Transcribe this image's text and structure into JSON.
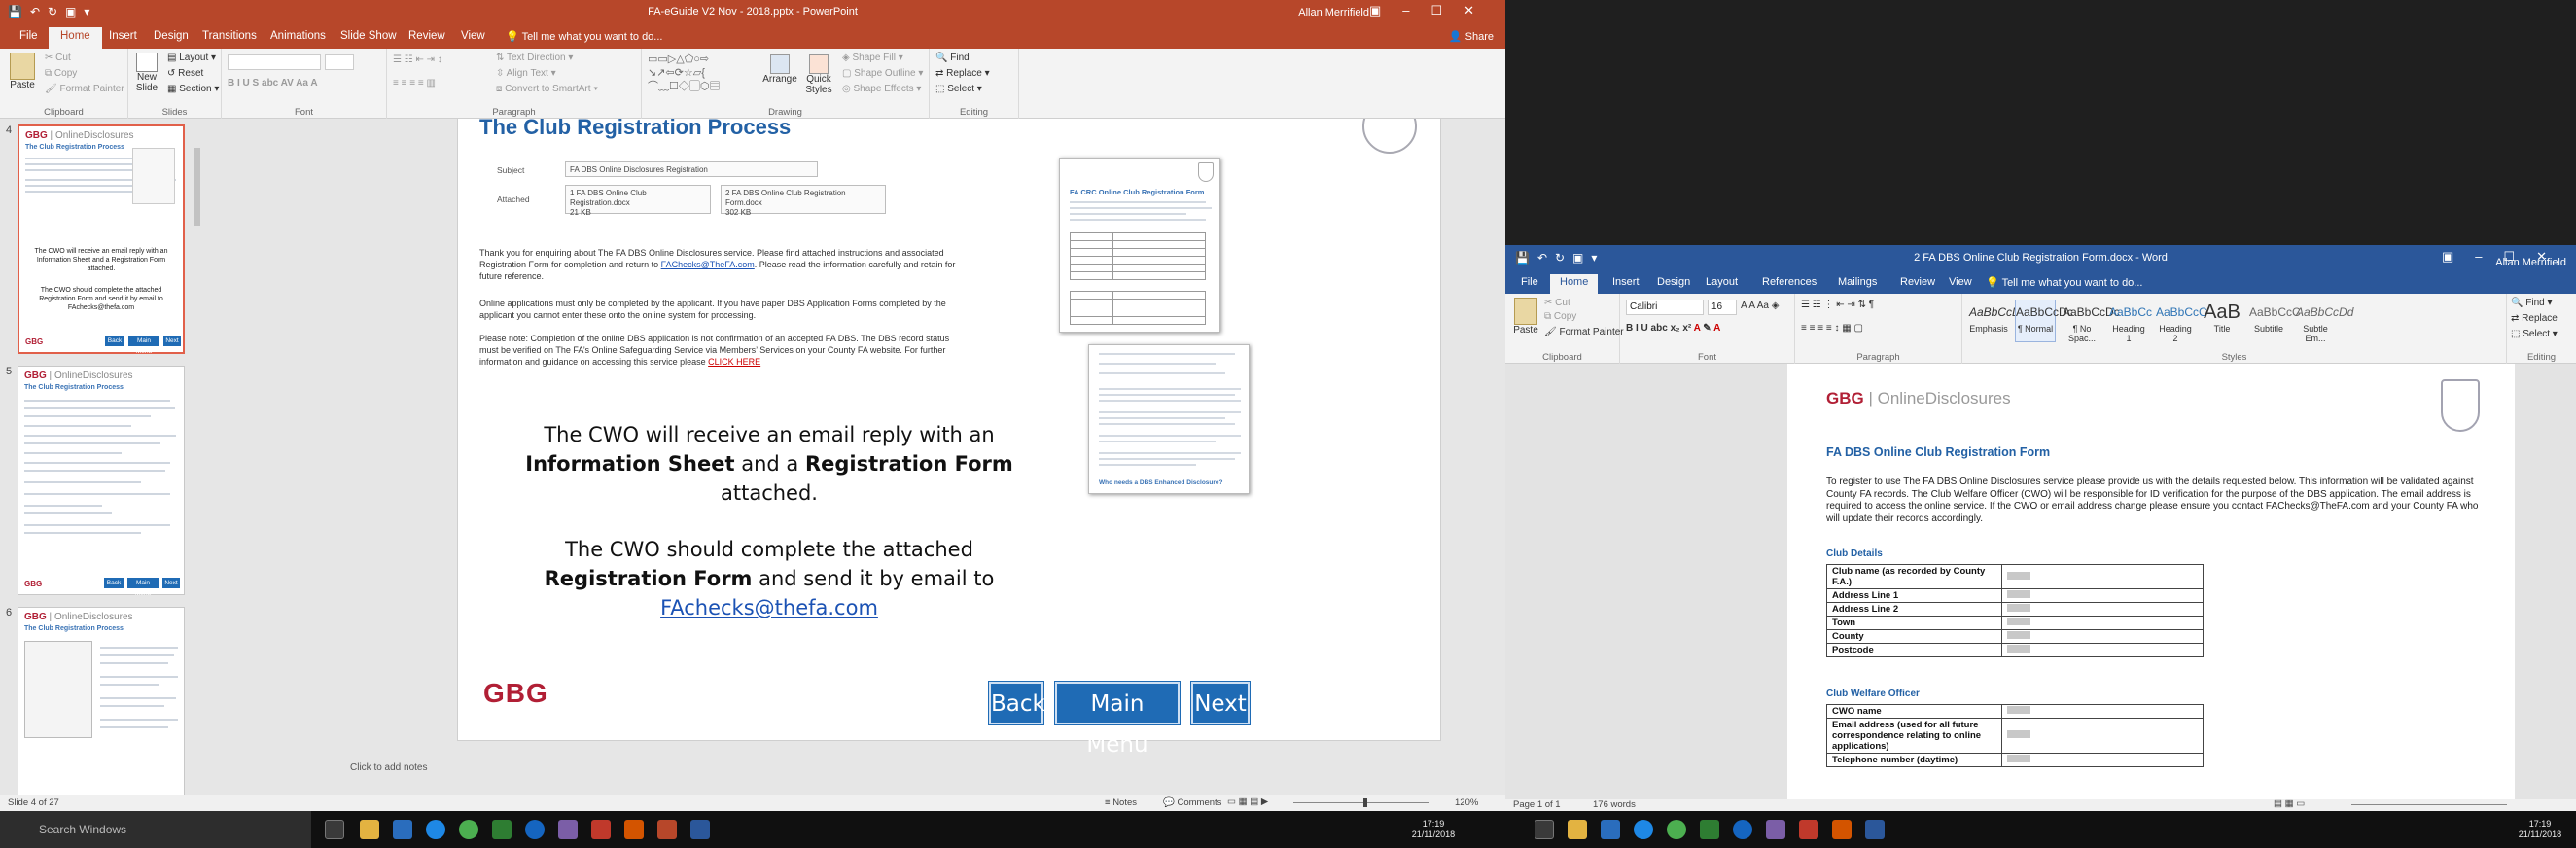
{
  "ppt": {
    "title": "FA-eGuide V2 Nov - 2018.pptx - PowerPoint",
    "user": "Allan Merrifield",
    "share": "Share",
    "tabs": [
      "File",
      "Home",
      "Insert",
      "Design",
      "Transitions",
      "Animations",
      "Slide Show",
      "Review",
      "View"
    ],
    "tell": "Tell me what you want to do...",
    "groups": [
      "Clipboard",
      "Slides",
      "Font",
      "Paragraph",
      "Drawing",
      "Editing"
    ],
    "ribbon": {
      "paste": "Paste",
      "cut": "Cut",
      "copy": "Copy",
      "format_painter": "Format Painter",
      "new_slide": "New Slide",
      "layout": "Layout",
      "reset": "Reset",
      "section": "Section",
      "text_direction": "Text Direction",
      "align_text": "Align Text",
      "convert_smartart": "Convert to SmartArt",
      "arrange": "Arrange",
      "quick_styles": "Quick Styles",
      "shape_fill": "Shape Fill",
      "shape_outline": "Shape Outline",
      "shape_effects": "Shape Effects",
      "find": "Find",
      "replace": "Replace",
      "select": "Select"
    },
    "slide_numbers": [
      "4",
      "5",
      "6"
    ],
    "thumb_title": "The Club Registration Process",
    "thumb_logo": "OnlineDisclosures",
    "thumb_buttons": [
      "Back",
      "Main Menu",
      "Next"
    ],
    "thumb4_text": [
      "The CWO will receive an email reply with an Information Sheet and a Registration Form attached.",
      "The CWO should complete the attached Registration Form and send it by email to FAchecks@thefa.com"
    ],
    "slide": {
      "title": "The Club Registration Process",
      "subject_label": "Subject",
      "subject_value": "FA DBS Online Disclosures Registration",
      "attached_label": "Attached",
      "att1": "1 FA DBS Online Club Registration.docx",
      "att1_size": "21 KB",
      "att2": "2 FA DBS Online Club Registration Form.docx",
      "att2_size": "302 KB",
      "p1a": "Thank you for enquiring about The FA DBS Online Disclosures service.  Please find attached instructions and associated Registration Form for completion and return to ",
      "p1_link": "FAChecks@TheFA.com",
      "p1b": ".  Please read the information carefully and retain for future reference.",
      "p2": "Online applications must only be completed by the applicant.  If you have paper DBS Application Forms completed by the applicant you cannot enter these onto the online system for processing.",
      "p3a": "Please note:  Completion of the online DBS application is not confirmation of an accepted FA DBS.  The DBS record status must be verified on The FA’s Online Safeguarding Service via Members’ Services on your County FA website.  For further information and guidance on accessing this service please ",
      "p3_link": "CLICK HERE",
      "big1a": "The CWO will receive an email reply with an",
      "big1b": "Information Sheet",
      "big1c": "and a",
      "big1d": "Registration Form",
      "big1e": "attached.",
      "big2a": "The CWO should complete the attached",
      "big2b": "Registration Form",
      "big2c": "and send it by email to",
      "big2_link": "FAchecks@thefa.com",
      "gbg": "GBG",
      "btn_back": "Back",
      "btn_menu": "Main Menu",
      "btn_next": "Next",
      "pic1_title": "FA CRC Online Club Registration Form",
      "pic2_heading": "Who needs a DBS Enhanced Disclosure?"
    },
    "notes": "Click to add notes",
    "status": "Slide 4 of 27",
    "status_notes": "Notes",
    "status_comments": "Comments",
    "zoom": "120%"
  },
  "word": {
    "title": "2 FA DBS Online Club Registration Form.docx - Word",
    "user": "Allan Merrifield",
    "tabs": [
      "File",
      "Home",
      "Insert",
      "Design",
      "Layout",
      "References",
      "Mailings",
      "Review",
      "View"
    ],
    "tell": "Tell me what you want to do...",
    "font": "Calibri",
    "size": "16",
    "groups": [
      "Clipboard",
      "Font",
      "Paragraph",
      "Styles",
      "Editing"
    ],
    "paste": "Paste",
    "cut": "Cut",
    "copy": "Copy",
    "format_painter": "Format Painter",
    "styles": [
      {
        "s": "AaBbCcDd",
        "n": "Emphasis"
      },
      {
        "s": "AaBbCcDc",
        "n": "¶ Normal"
      },
      {
        "s": "AaBbCcDc",
        "n": "¶ No Spac..."
      },
      {
        "s": "AaBbCc",
        "n": "Heading 1"
      },
      {
        "s": "AaBbCcC",
        "n": "Heading 2"
      },
      {
        "s": "AaB",
        "n": "Title"
      },
      {
        "s": "AaBbCcC",
        "n": "Subtitle"
      },
      {
        "s": "AaBbCcDd",
        "n": "Subtle Em..."
      }
    ],
    "find": "Find",
    "replace": "Replace",
    "select": "Select",
    "doc": {
      "logo_a": "GBG",
      "logo_b": "OnlineDisclosures",
      "heading": "FA DBS Online Club Registration Form",
      "intro": "To register to use The FA DBS Online Disclosures service please provide us with the details requested below.  This information will be validated against County FA records.  The Club Welfare Officer (CWO) will be responsible for ID verification for the purpose of the DBS application. The email address is required to access the online service.  If the CWO or email address change please ensure you contact FAChecks@TheFA.com and your County FA who will update their records accordingly.",
      "club_details": "Club Details",
      "club_rows": [
        "Club name (as recorded by County F.A.)",
        "Address Line 1",
        "Address Line 2",
        "Town",
        "County",
        "Postcode"
      ],
      "cwo": "Club Welfare Officer",
      "cwo_rows": [
        "CWO name",
        "Email address (used for all future correspondence relating to online applications)",
        "Telephone number (daytime)"
      ]
    },
    "status": "Page 1 of 1",
    "words": "176 words"
  },
  "taskbar": {
    "search": "Search Windows",
    "time": "17:19",
    "date": "21/11/2018"
  }
}
